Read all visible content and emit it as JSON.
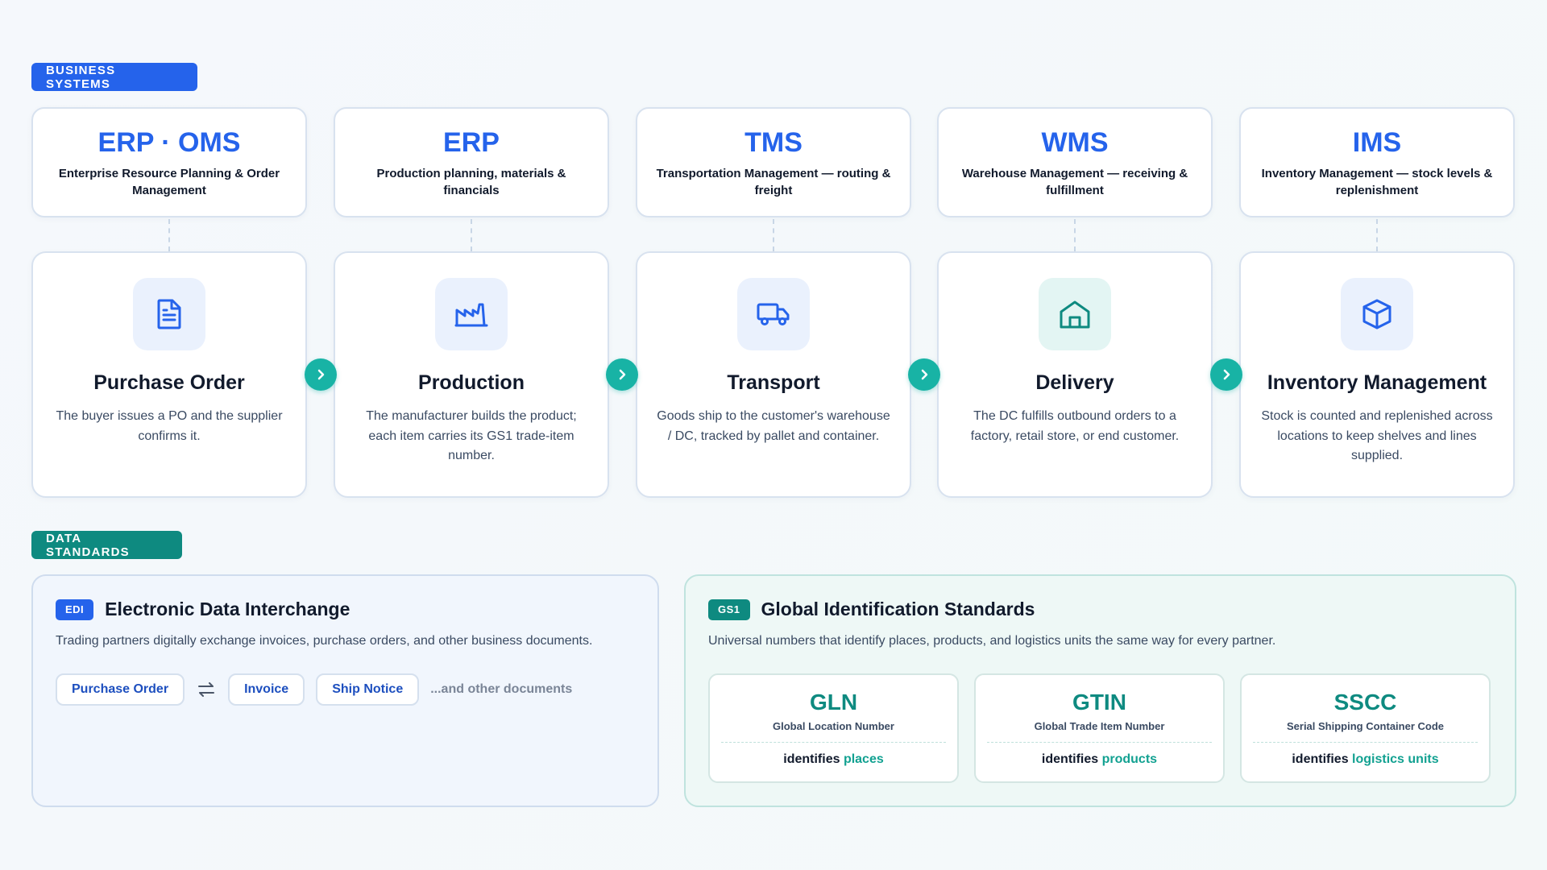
{
  "sections": {
    "business_label": "BUSINESS SYSTEMS",
    "standards_label": "DATA STANDARDS"
  },
  "systems": [
    {
      "title": "ERP · OMS",
      "desc": "Enterprise Resource Planning & Order Management"
    },
    {
      "title": "ERP",
      "desc": "Production planning, materials & financials"
    },
    {
      "title": "TMS",
      "desc": "Transportation Management — routing & freight"
    },
    {
      "title": "WMS",
      "desc": "Warehouse Management — receiving & fulfillment"
    },
    {
      "title": "IMS",
      "desc": "Inventory Management — stock levels & replenishment"
    }
  ],
  "stages": [
    {
      "icon": "document-icon",
      "title": "Purchase Order",
      "desc": "The buyer issues a PO and the supplier confirms it."
    },
    {
      "icon": "factory-icon",
      "title": "Production",
      "desc": "The manufacturer builds the product; each item carries its GS1 trade-item number."
    },
    {
      "icon": "truck-icon",
      "title": "Transport",
      "desc": "Goods ship to the customer's warehouse / DC, tracked by pallet and container."
    },
    {
      "icon": "warehouse-icon",
      "title": "Delivery",
      "desc": "The DC fulfills outbound orders to a factory, retail store, or end customer."
    },
    {
      "icon": "box-icon",
      "title": "Inventory Management",
      "desc": "Stock is counted and replenished across locations to keep shelves and lines supplied."
    }
  ],
  "edi": {
    "tag": "EDI",
    "title": "Electronic Data Interchange",
    "desc": "Trading partners digitally exchange invoices, purchase orders, and other business documents.",
    "docs": [
      "Purchase Order",
      "Invoice",
      "Ship Notice"
    ],
    "more": "...and other documents"
  },
  "gs1": {
    "tag": "GS1",
    "title": "Global Identification Standards",
    "desc": "Universal numbers that identify places, products, and logistics units the same way for every partner.",
    "ids": [
      {
        "title": "GLN",
        "sub": "Global Location Number",
        "prefix": "identifies",
        "object": "places"
      },
      {
        "title": "GTIN",
        "sub": "Global Trade Item Number",
        "prefix": "identifies",
        "object": "products"
      },
      {
        "title": "SSCC",
        "sub": "Serial Shipping Container Code",
        "prefix": "identifies",
        "object": "logistics units"
      }
    ]
  },
  "colors": {
    "primary_blue": "#2563eb",
    "teal": "#0e8a80",
    "arrow_teal": "#18b3a5"
  }
}
